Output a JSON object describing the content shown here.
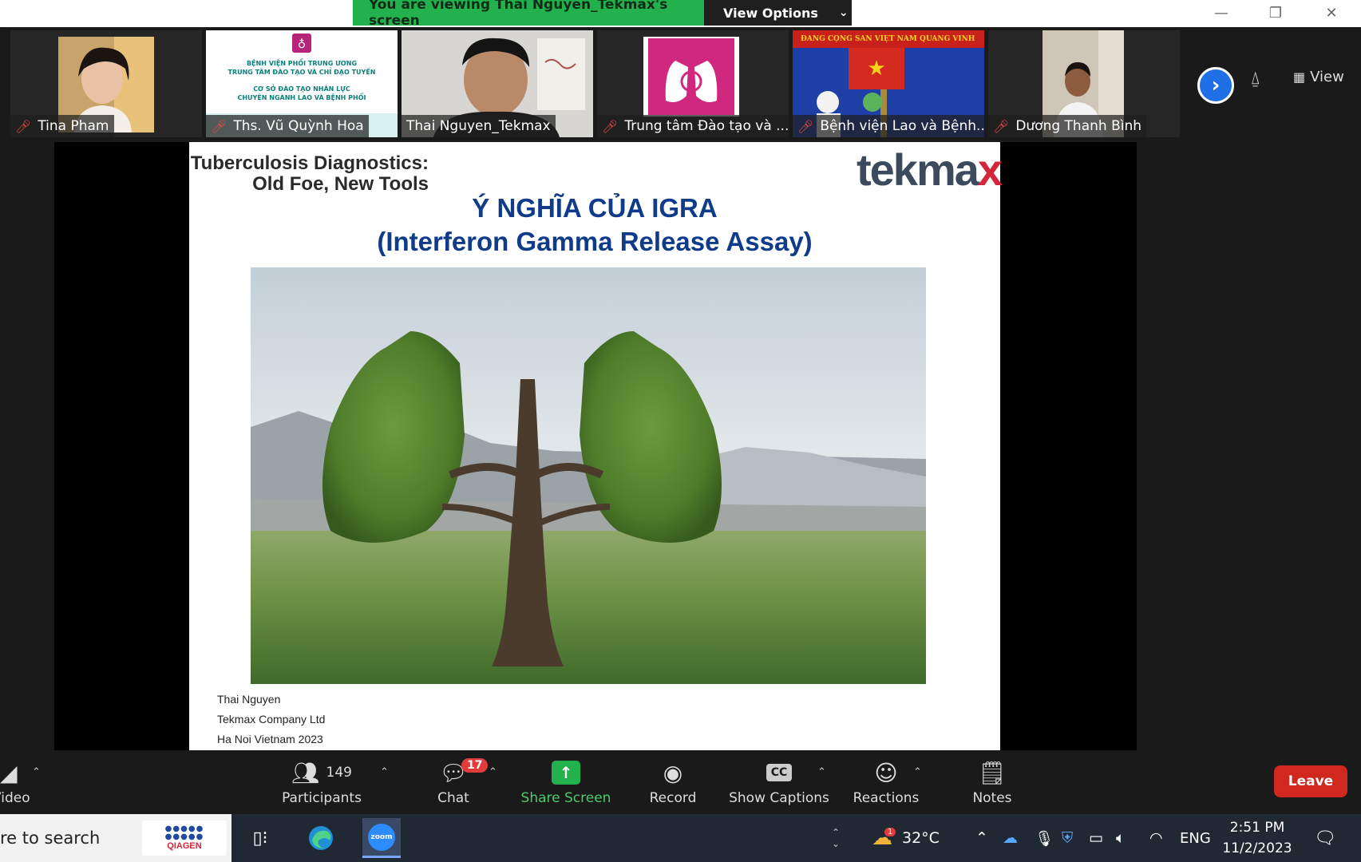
{
  "titlebar": {
    "banner": "You are viewing Thai Nguyen_Tekmax's screen",
    "view_options": "View Options"
  },
  "participants_strip": [
    {
      "name": "Tina Pham",
      "muted": true
    },
    {
      "name": "Ths. Vũ Quỳnh Hoa",
      "muted": true
    },
    {
      "name": "Thai Nguyen_Tekmax",
      "muted": false,
      "active_speaker": true
    },
    {
      "name": "Trung tâm Đào tạo và ...",
      "muted": true
    },
    {
      "name": "Bệnh viện Lao và Bệnh...",
      "muted": true
    },
    {
      "name": "Dương Thanh Bình",
      "muted": true
    }
  ],
  "strip_controls": {
    "view_label": "View"
  },
  "slide": {
    "kicker_line1": "Tuberculosis Diagnostics:",
    "kicker_line2": "Old Foe, New Tools",
    "logo_a": "tek",
    "logo_b": "ma",
    "logo_c": "x",
    "title_line1": "Ý NGHĨA CỦA IGRA",
    "title_line2": "(Interferon Gamma Release Assay)",
    "footer": [
      "Thai Nguyen",
      "Tekmax Company Ltd",
      "Ha Noi Vietnam 2023"
    ]
  },
  "thumb_texts": {
    "hoa_line1": "BỆNH VIỆN PHỔI TRUNG ƯƠNG",
    "hoa_line2": "TRUNG TÂM ĐÀO TẠO VÀ CHỈ ĐẠO TUYẾN",
    "hoa_line3": "CƠ SỞ ĐÀO TẠO NHÂN LỰC",
    "hoa_line4": "CHUYÊN NGÀNH LAO VÀ BỆNH PHỔI",
    "banner_party": "ĐẢNG CỘNG SẢN VIỆT NAM QUANG VINH"
  },
  "toolbar": {
    "video_label": "Video",
    "participants_count": "149",
    "participants_label": "Participants",
    "chat_badge": "17",
    "chat_label": "Chat",
    "share_label": "Share Screen",
    "record_label": "Record",
    "captions_icon": "CC",
    "captions_label": "Show Captions",
    "reactions_label": "Reactions",
    "notes_label": "Notes",
    "leave_label": "Leave"
  },
  "taskbar": {
    "search_text": "re to search",
    "qiagen": "QIAGEN",
    "zoom": "zoom",
    "weather_badge": "1",
    "temperature": "32°C",
    "language": "ENG",
    "time": "2:51 PM",
    "date": "11/2/2023"
  },
  "colors": {
    "share_green": "#23b14d",
    "leave_red": "#d0281f",
    "slide_title_blue": "#0f3b8a",
    "active_outline": "#8fcf4a"
  }
}
